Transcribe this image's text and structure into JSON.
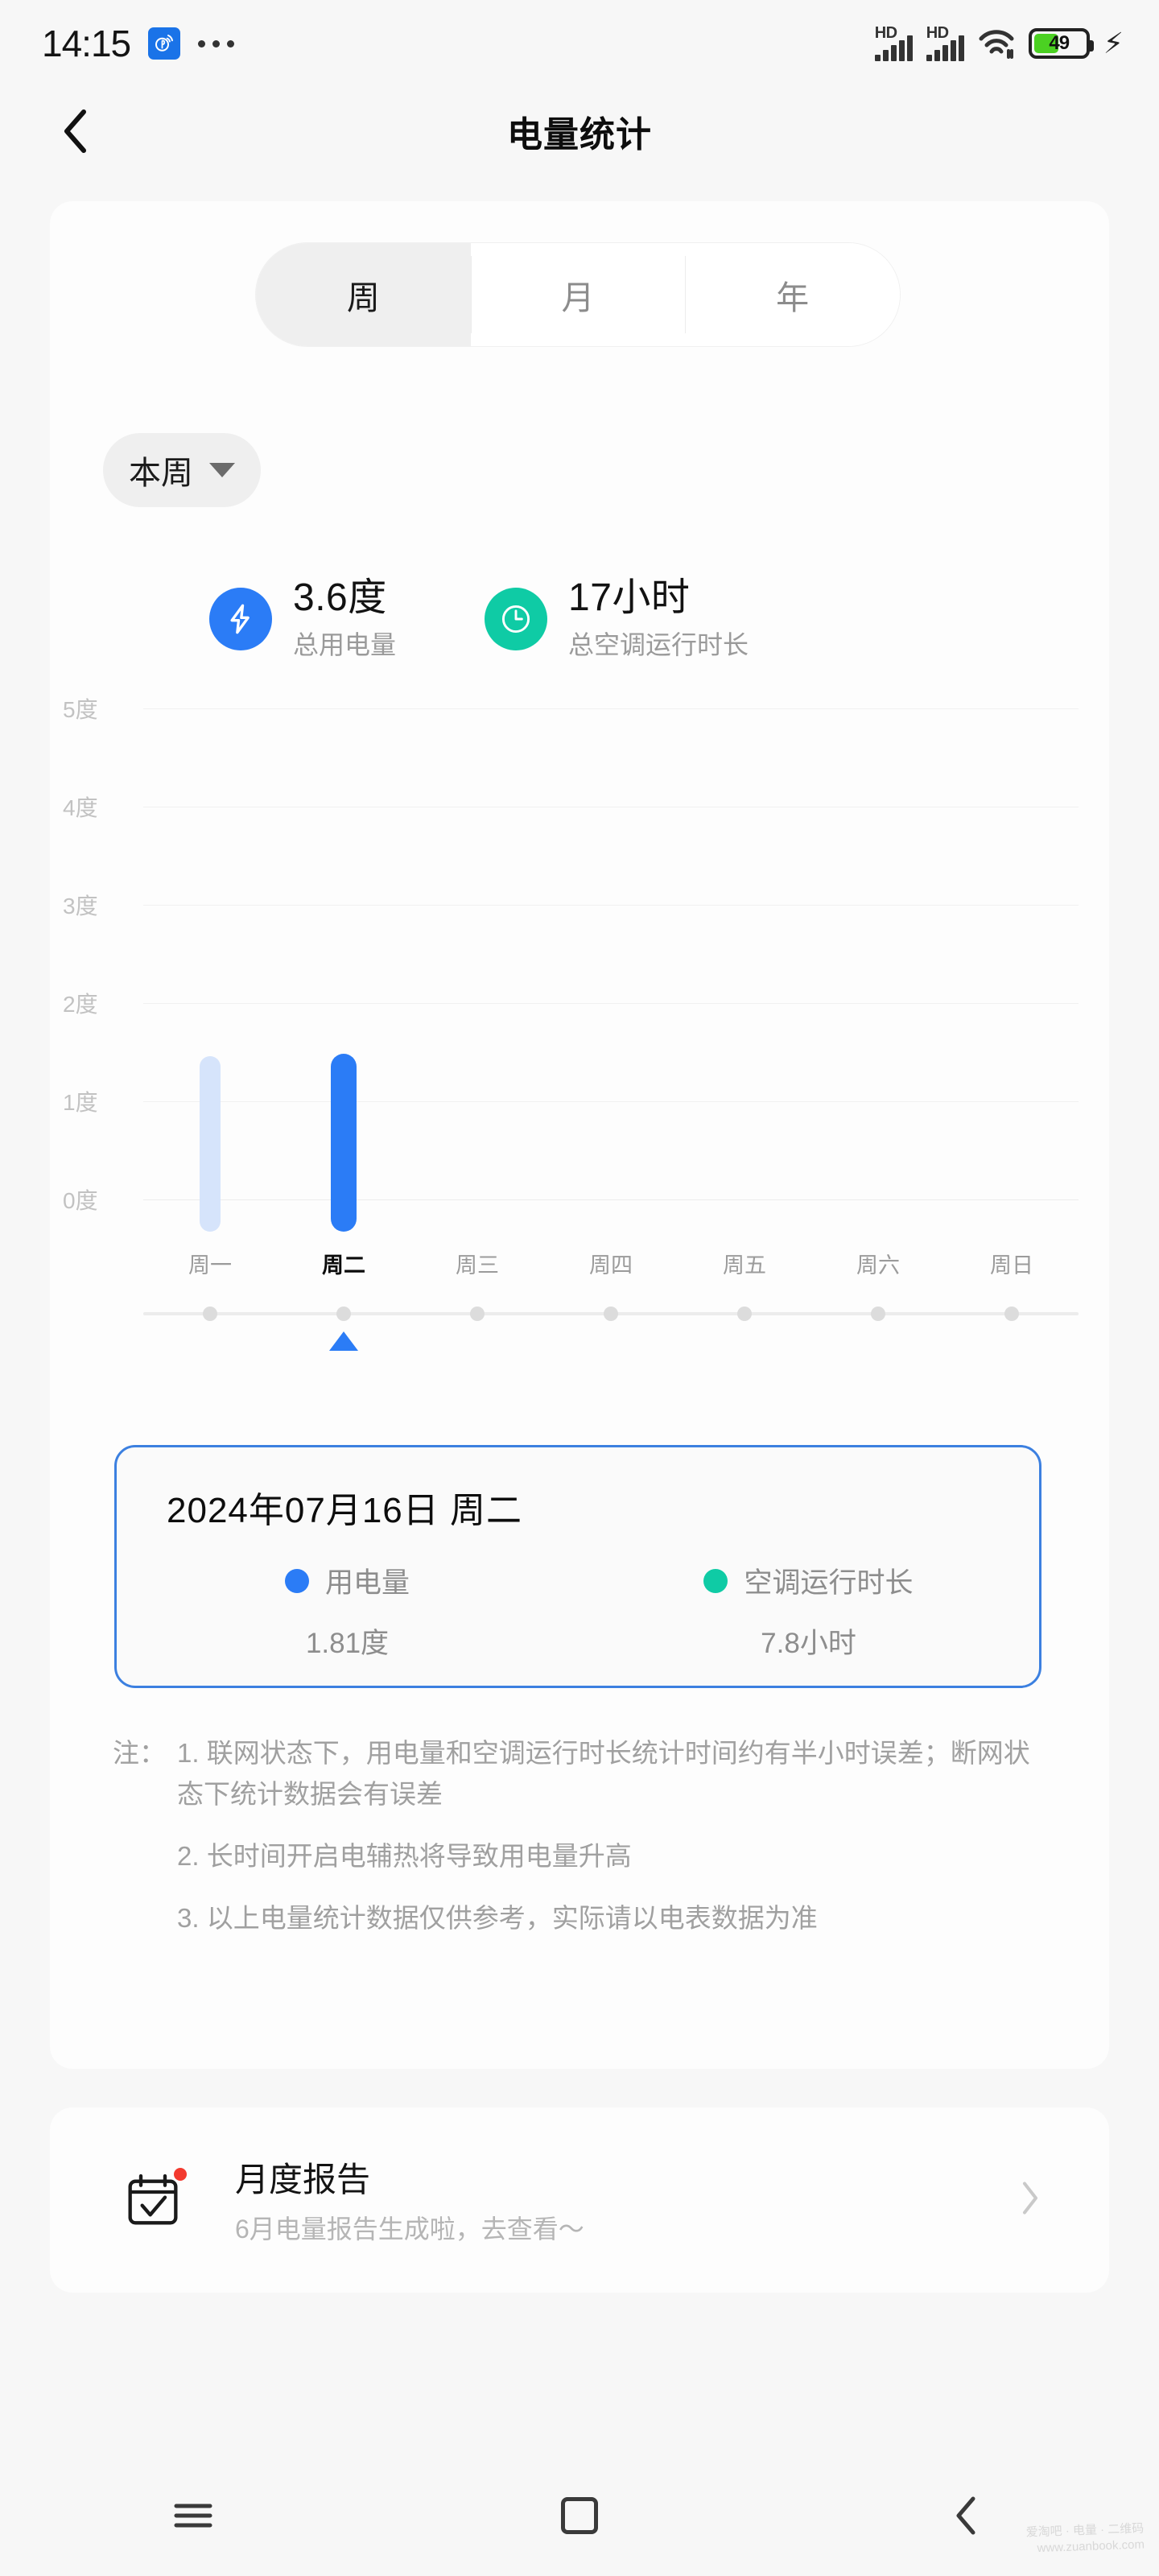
{
  "status_bar": {
    "time": "14:15",
    "app_icon": "signal-app-icon",
    "more_icon": "more-dots-icon",
    "network_label_1": "HD",
    "network_label_2": "HD",
    "wifi_icon": "wifi-icon",
    "battery_percent": "49",
    "charging_icon": "lightning-bolt-icon"
  },
  "header": {
    "back_icon": "chevron-left-icon",
    "title": "电量统计"
  },
  "period_tabs": {
    "items": [
      {
        "label": "周",
        "selected": true
      },
      {
        "label": "月",
        "selected": false
      },
      {
        "label": "年",
        "selected": false
      }
    ]
  },
  "range_select": {
    "value": "本周",
    "caret_icon": "chevron-down-icon"
  },
  "summary": {
    "items": [
      {
        "icon": "power-bolt-icon",
        "value": "3.6度",
        "label": "总用电量",
        "color": "#2b7cf6"
      },
      {
        "icon": "clock-icon",
        "value": "17小时",
        "label": "总空调运行时长",
        "color": "#0fcba5"
      }
    ]
  },
  "chart_data": {
    "type": "bar",
    "title": "",
    "xlabel": "",
    "ylabel": "度",
    "categories": [
      "周一",
      "周二",
      "周三",
      "周四",
      "周五",
      "周六",
      "周日"
    ],
    "values": [
      1.79,
      1.81,
      0,
      0,
      0,
      0,
      0
    ],
    "ytick_labels": [
      "5度",
      "4度",
      "3度",
      "2度",
      "1度",
      "0度"
    ],
    "yticks": [
      5,
      4,
      3,
      2,
      1,
      0
    ],
    "ylim": [
      0,
      5
    ],
    "grid": true,
    "legend": "none",
    "selected_index": 1,
    "bar_color": "#d6e4fb",
    "bar_color_selected": "#2b7cf6"
  },
  "selection_detail": {
    "date": "2024年07月16日  周二",
    "metrics": [
      {
        "dot_color": "#2b7cf6",
        "label": "用电量",
        "value": "1.81度"
      },
      {
        "dot_color": "#0fcba5",
        "label": "空调运行时长",
        "value": "7.8小时"
      }
    ]
  },
  "notes": {
    "prefix": "注：",
    "items": [
      "1. 联网状态下，用电量和空调运行时长统计时间约有半小时误差；断网状态下统计数据会有误差",
      "2. 长时间开启电辅热将导致用电量升高",
      "3. 以上电量统计数据仅供参考，实际请以电表数据为准"
    ]
  },
  "monthly_report": {
    "icon": "calendar-check-icon",
    "badge": "notification-dot",
    "title": "月度报告",
    "subtitle": "6月电量报告生成啦，去查看～",
    "chevron_icon": "chevron-right-icon"
  },
  "nav_bar": {
    "recents_icon": "menu-lines-icon",
    "home_icon": "home-square-icon",
    "back_icon": "chevron-left-icon"
  },
  "watermark": {
    "line1": "爱淘吧 · 电量 · 二维码",
    "line2": "www.zuanbook.com"
  }
}
